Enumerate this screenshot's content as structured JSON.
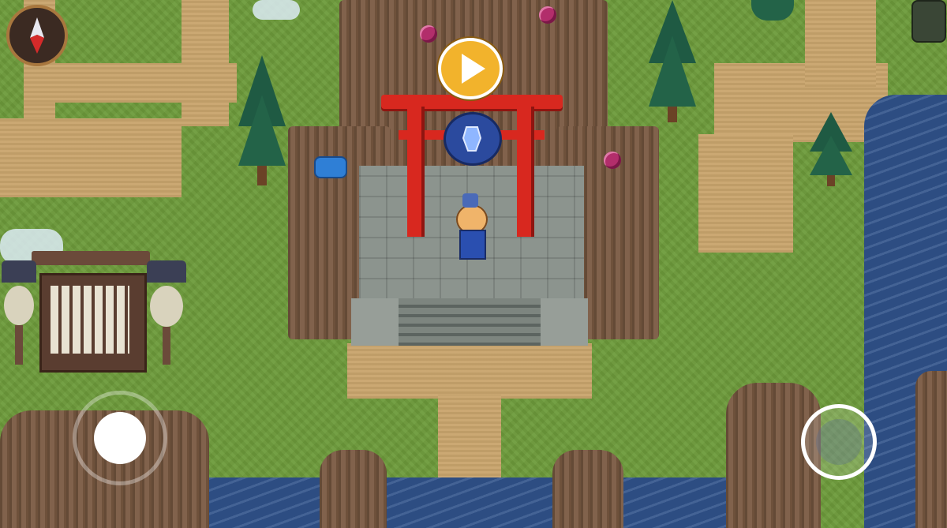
{
  "game": {
    "scene": "shrine-clearing",
    "colors": {
      "grass": "#6d9b3b",
      "path": "#c9a56d",
      "rock": "#7a5a42",
      "water": "#2f5189",
      "torii": "#d8281f",
      "stone": "#8c948e",
      "play_button": "#f2b32c"
    }
  },
  "hud": {
    "compass_icon": "compass-icon",
    "play_icon": "play-icon",
    "joystick_icon": "joystick-icon",
    "action_icon": "action-button-icon"
  },
  "shrine": {
    "gate_emblem_icon": "crystal-emblem-icon"
  }
}
